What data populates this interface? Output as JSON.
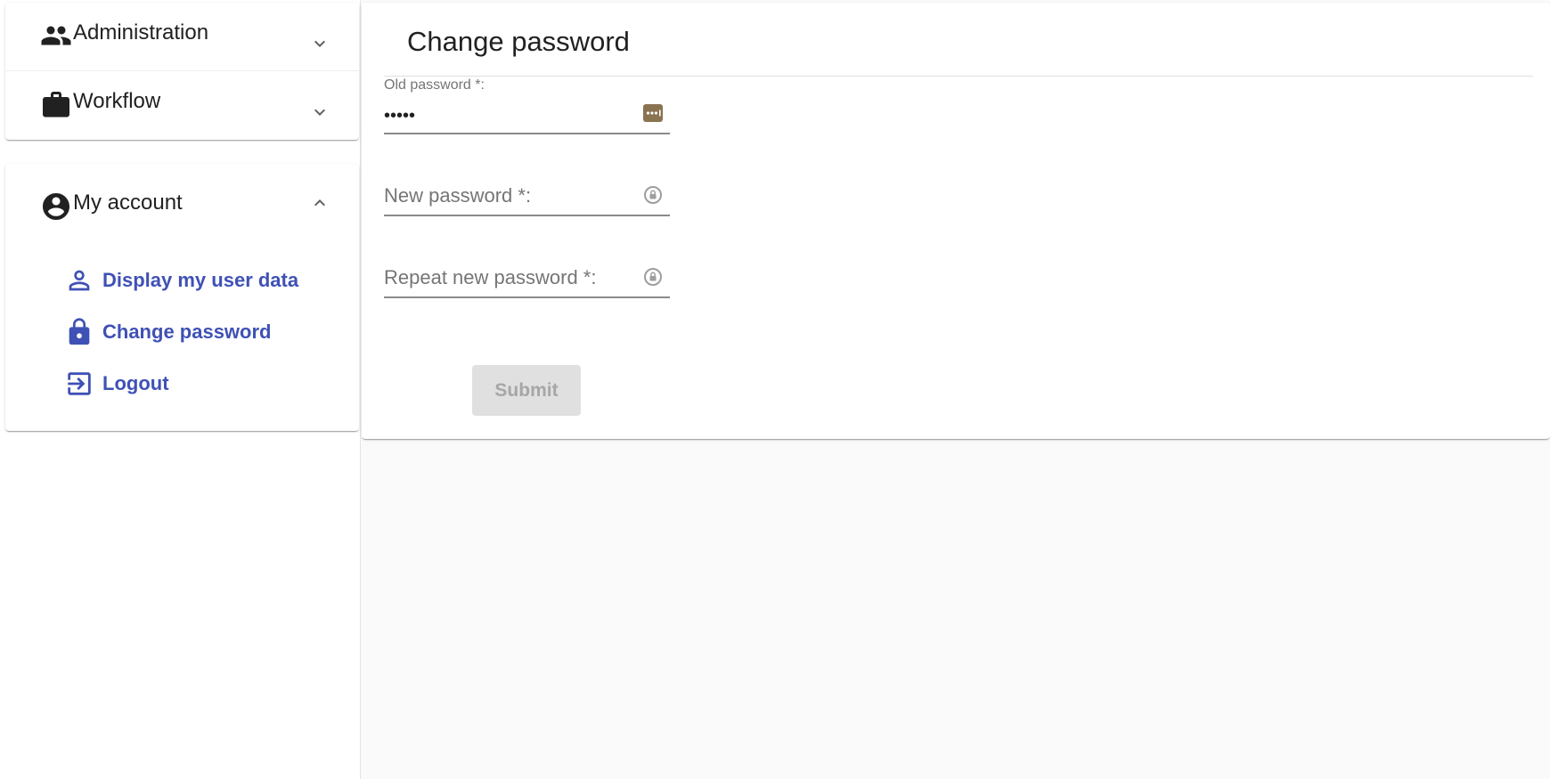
{
  "sidebar": {
    "sections": [
      {
        "title": "Administration",
        "icon": "people-icon",
        "expanded": false
      },
      {
        "title": "Workflow",
        "icon": "briefcase-icon",
        "expanded": false
      },
      {
        "title": "My account",
        "icon": "account-circle-icon",
        "expanded": true
      }
    ],
    "account_items": [
      {
        "label": "Display my user data",
        "icon": "person-outline-icon"
      },
      {
        "label": "Change password",
        "icon": "lock-icon"
      },
      {
        "label": "Logout",
        "icon": "logout-icon"
      }
    ]
  },
  "main": {
    "title": "Change password",
    "fields": {
      "old_password": {
        "label": "Old password *:",
        "value": "•••••"
      },
      "new_password": {
        "label": "New password *:",
        "value": ""
      },
      "repeat_password": {
        "label": "Repeat new password *:",
        "value": ""
      }
    },
    "submit_label": "Submit"
  },
  "colors": {
    "accent": "#3f51b5",
    "text_primary": "#212121",
    "text_secondary": "#757575",
    "disabled_bg": "#e0e0e0",
    "disabled_text": "#a6a6a6",
    "password_manager_icon": "#8a7350"
  }
}
